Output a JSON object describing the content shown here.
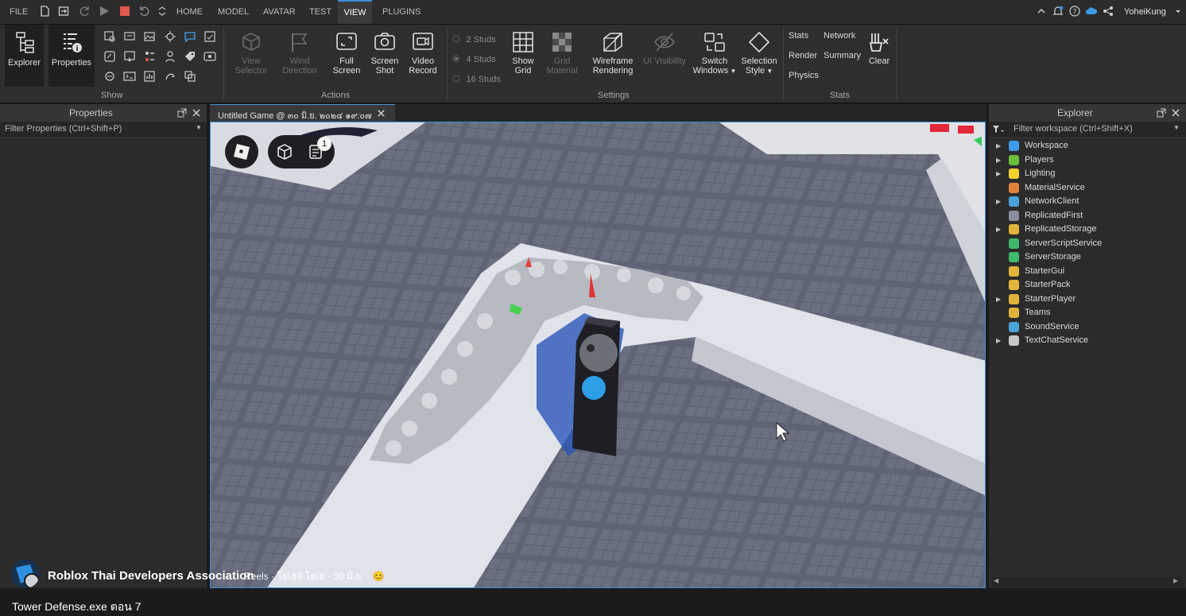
{
  "menu": {
    "file": "FILE",
    "tabs": [
      "HOME",
      "MODEL",
      "AVATAR",
      "TEST",
      "VIEW",
      "PLUGINS"
    ],
    "active_tab": "VIEW",
    "username": "YoheiKung"
  },
  "ribbon": {
    "explorer": "Explorer",
    "properties": "Properties",
    "show_group": "Show",
    "view_selector": [
      "View",
      "Selector"
    ],
    "wind_direction": [
      "Wind",
      "Direction"
    ],
    "full_screen": [
      "Full",
      "Screen"
    ],
    "screen_shot": [
      "Screen",
      "Shot"
    ],
    "video_record": [
      "Video",
      "Record"
    ],
    "actions_group": "Actions",
    "studs": [
      "2 Studs",
      "4 Studs",
      "16 Studs"
    ],
    "show_grid": [
      "Show",
      "Grid"
    ],
    "grid_material": [
      "Grid",
      "Material"
    ],
    "wireframe": [
      "Wireframe",
      "Rendering"
    ],
    "ui_visibility": "UI Visibility",
    "switch_windows": [
      "Switch",
      "Windows"
    ],
    "selection_style": [
      "Selection",
      "Style"
    ],
    "settings_group": "Settings",
    "stats": "Stats",
    "network": "Network",
    "render": "Render",
    "summary": "Summary",
    "physics": "Physics",
    "clear": "Clear",
    "stats_group": "Stats"
  },
  "properties_panel": {
    "title": "Properties",
    "filter_placeholder": "Filter Properties (Ctrl+Shift+P)"
  },
  "viewport": {
    "tab_title": "Untitled Game @ ๓๐ มิ.ย. ๒๐๒๔ ๑๙:๐๗",
    "notification_count": "1"
  },
  "explorer_panel": {
    "title": "Explorer",
    "filter_placeholder": "Filter workspace (Ctrl+Shift+X)",
    "items": [
      {
        "label": "Workspace",
        "expandable": true,
        "color": "#3d9be9"
      },
      {
        "label": "Players",
        "expandable": true,
        "color": "#6abf3a"
      },
      {
        "label": "Lighting",
        "expandable": true,
        "color": "#f2d22e"
      },
      {
        "label": "MaterialService",
        "expandable": false,
        "color": "#e3823a"
      },
      {
        "label": "NetworkClient",
        "expandable": true,
        "color": "#4aa3d8"
      },
      {
        "label": "ReplicatedFirst",
        "expandable": false,
        "color": "#8a8fa0"
      },
      {
        "label": "ReplicatedStorage",
        "expandable": true,
        "color": "#e0b43a"
      },
      {
        "label": "ServerScriptService",
        "expandable": false,
        "color": "#3fb96b"
      },
      {
        "label": "ServerStorage",
        "expandable": false,
        "color": "#3fb96b"
      },
      {
        "label": "StarterGui",
        "expandable": false,
        "color": "#e0b43a"
      },
      {
        "label": "StarterPack",
        "expandable": false,
        "color": "#e0b43a"
      },
      {
        "label": "StarterPlayer",
        "expandable": true,
        "color": "#e0b43a"
      },
      {
        "label": "Teams",
        "expandable": false,
        "color": "#e0b43a"
      },
      {
        "label": "SoundService",
        "expandable": false,
        "color": "#4aa3d8"
      },
      {
        "label": "TextChatService",
        "expandable": true,
        "color": "#c8c8c8"
      }
    ]
  },
  "overlay": {
    "page_name": "Roblox Thai Developers Association",
    "meta": "Reels · โยเฮลิ โยเฮ · 30 มิ.ย. · 😊",
    "caption": "Tower Defense.exe ตอน 7"
  }
}
